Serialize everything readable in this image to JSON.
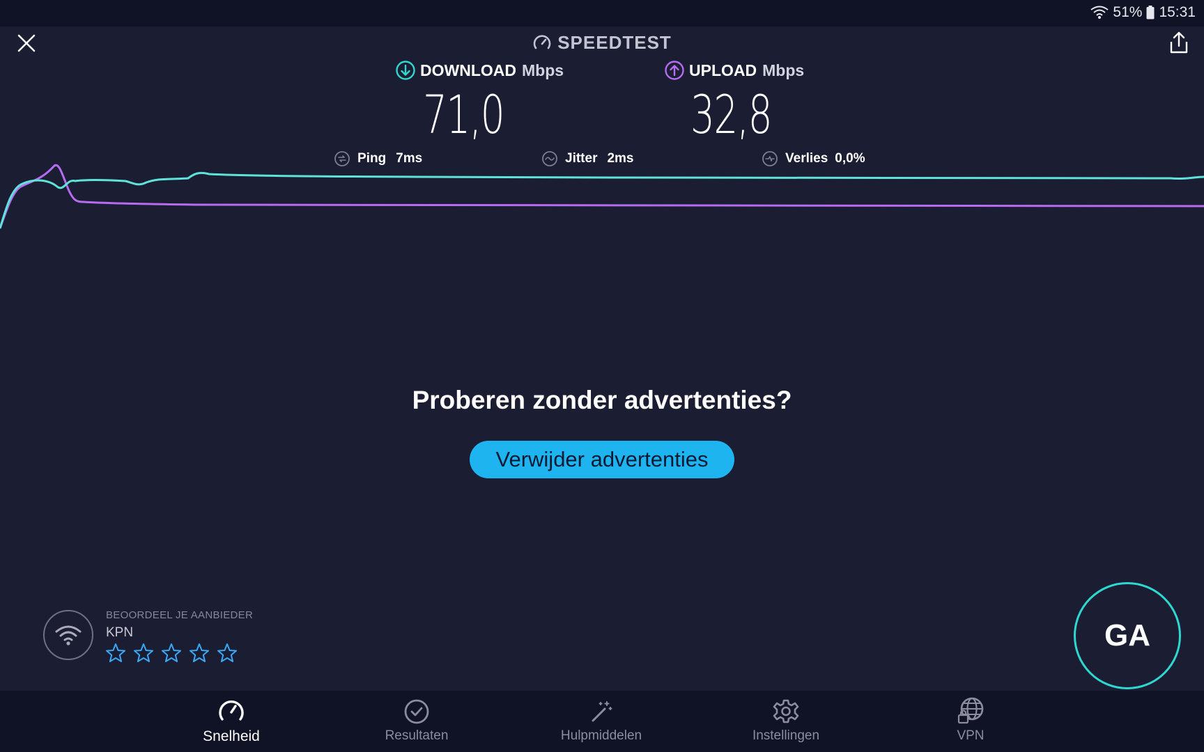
{
  "statusbar": {
    "battery": "51%",
    "time": "15:31"
  },
  "header": {
    "title": "SPEEDTEST"
  },
  "download": {
    "label": "DOWNLOAD",
    "unit": "Mbps",
    "value": "71,0",
    "color": "#2fd8cf"
  },
  "upload": {
    "label": "UPLOAD",
    "unit": "Mbps",
    "value": "32,8",
    "color": "#b56cf0"
  },
  "stats": {
    "ping_label": "Ping",
    "ping_value": "7ms",
    "jitter_label": "Jitter",
    "jitter_value": "2ms",
    "loss_label": "Verlies",
    "loss_value": "0,0%"
  },
  "promo": {
    "title": "Proberen zonder advertenties?",
    "button": "Verwijder advertenties",
    "button_color": "#1eb4f0"
  },
  "provider": {
    "rate_label": "BEOORDEEL JE AANBIEDER",
    "name": "KPN",
    "stars": 5
  },
  "go_button": {
    "label": "GA"
  },
  "nav": [
    {
      "label": "Snelheid",
      "icon": "speedometer-icon",
      "active": true
    },
    {
      "label": "Resultaten",
      "icon": "check-circle-icon",
      "active": false
    },
    {
      "label": "Hulpmiddelen",
      "icon": "magic-wand-icon",
      "active": false
    },
    {
      "label": "Instellingen",
      "icon": "gear-icon",
      "active": false
    },
    {
      "label": "VPN",
      "icon": "globe-lock-icon",
      "active": false
    }
  ]
}
